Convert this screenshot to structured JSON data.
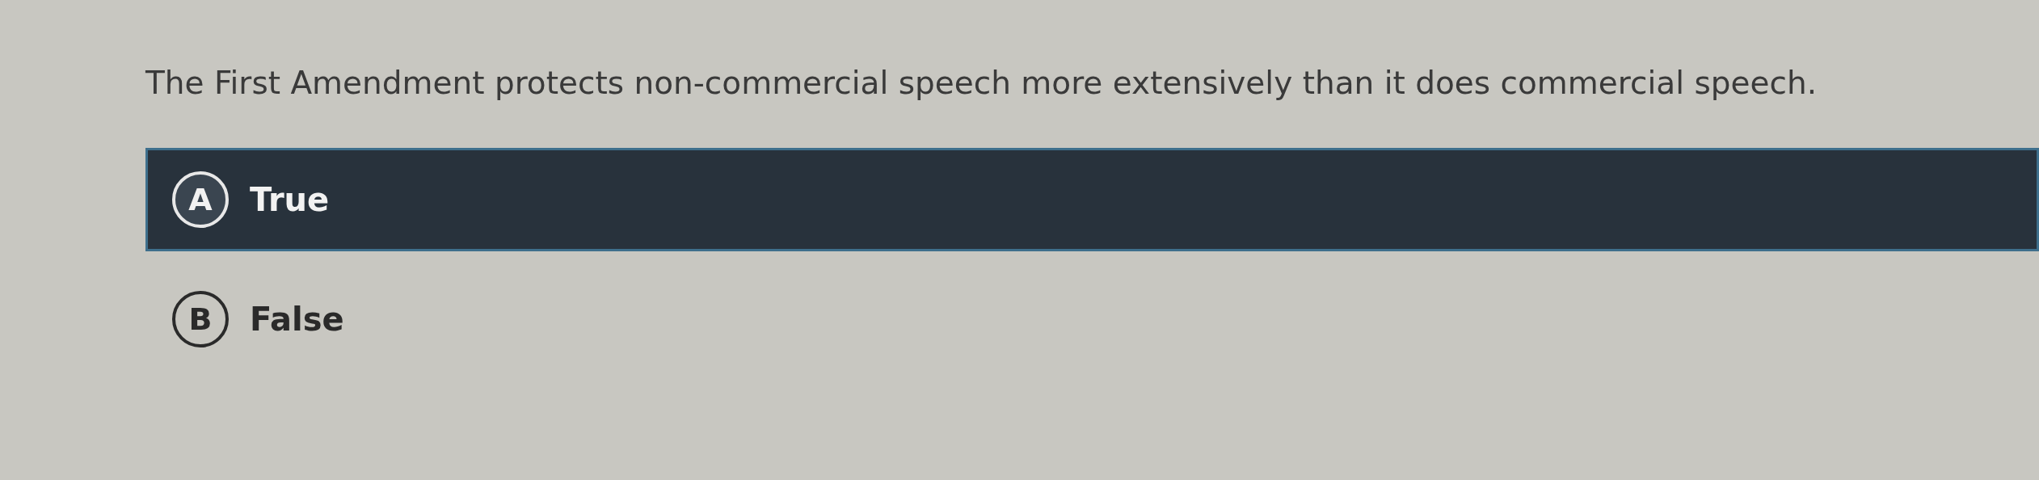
{
  "question": "The First Amendment protects non-commercial speech more extensively than it does commercial speech.",
  "options": [
    {
      "letter": "A",
      "label": "True",
      "selected": true
    },
    {
      "letter": "B",
      "label": "False",
      "selected": false
    }
  ]
}
